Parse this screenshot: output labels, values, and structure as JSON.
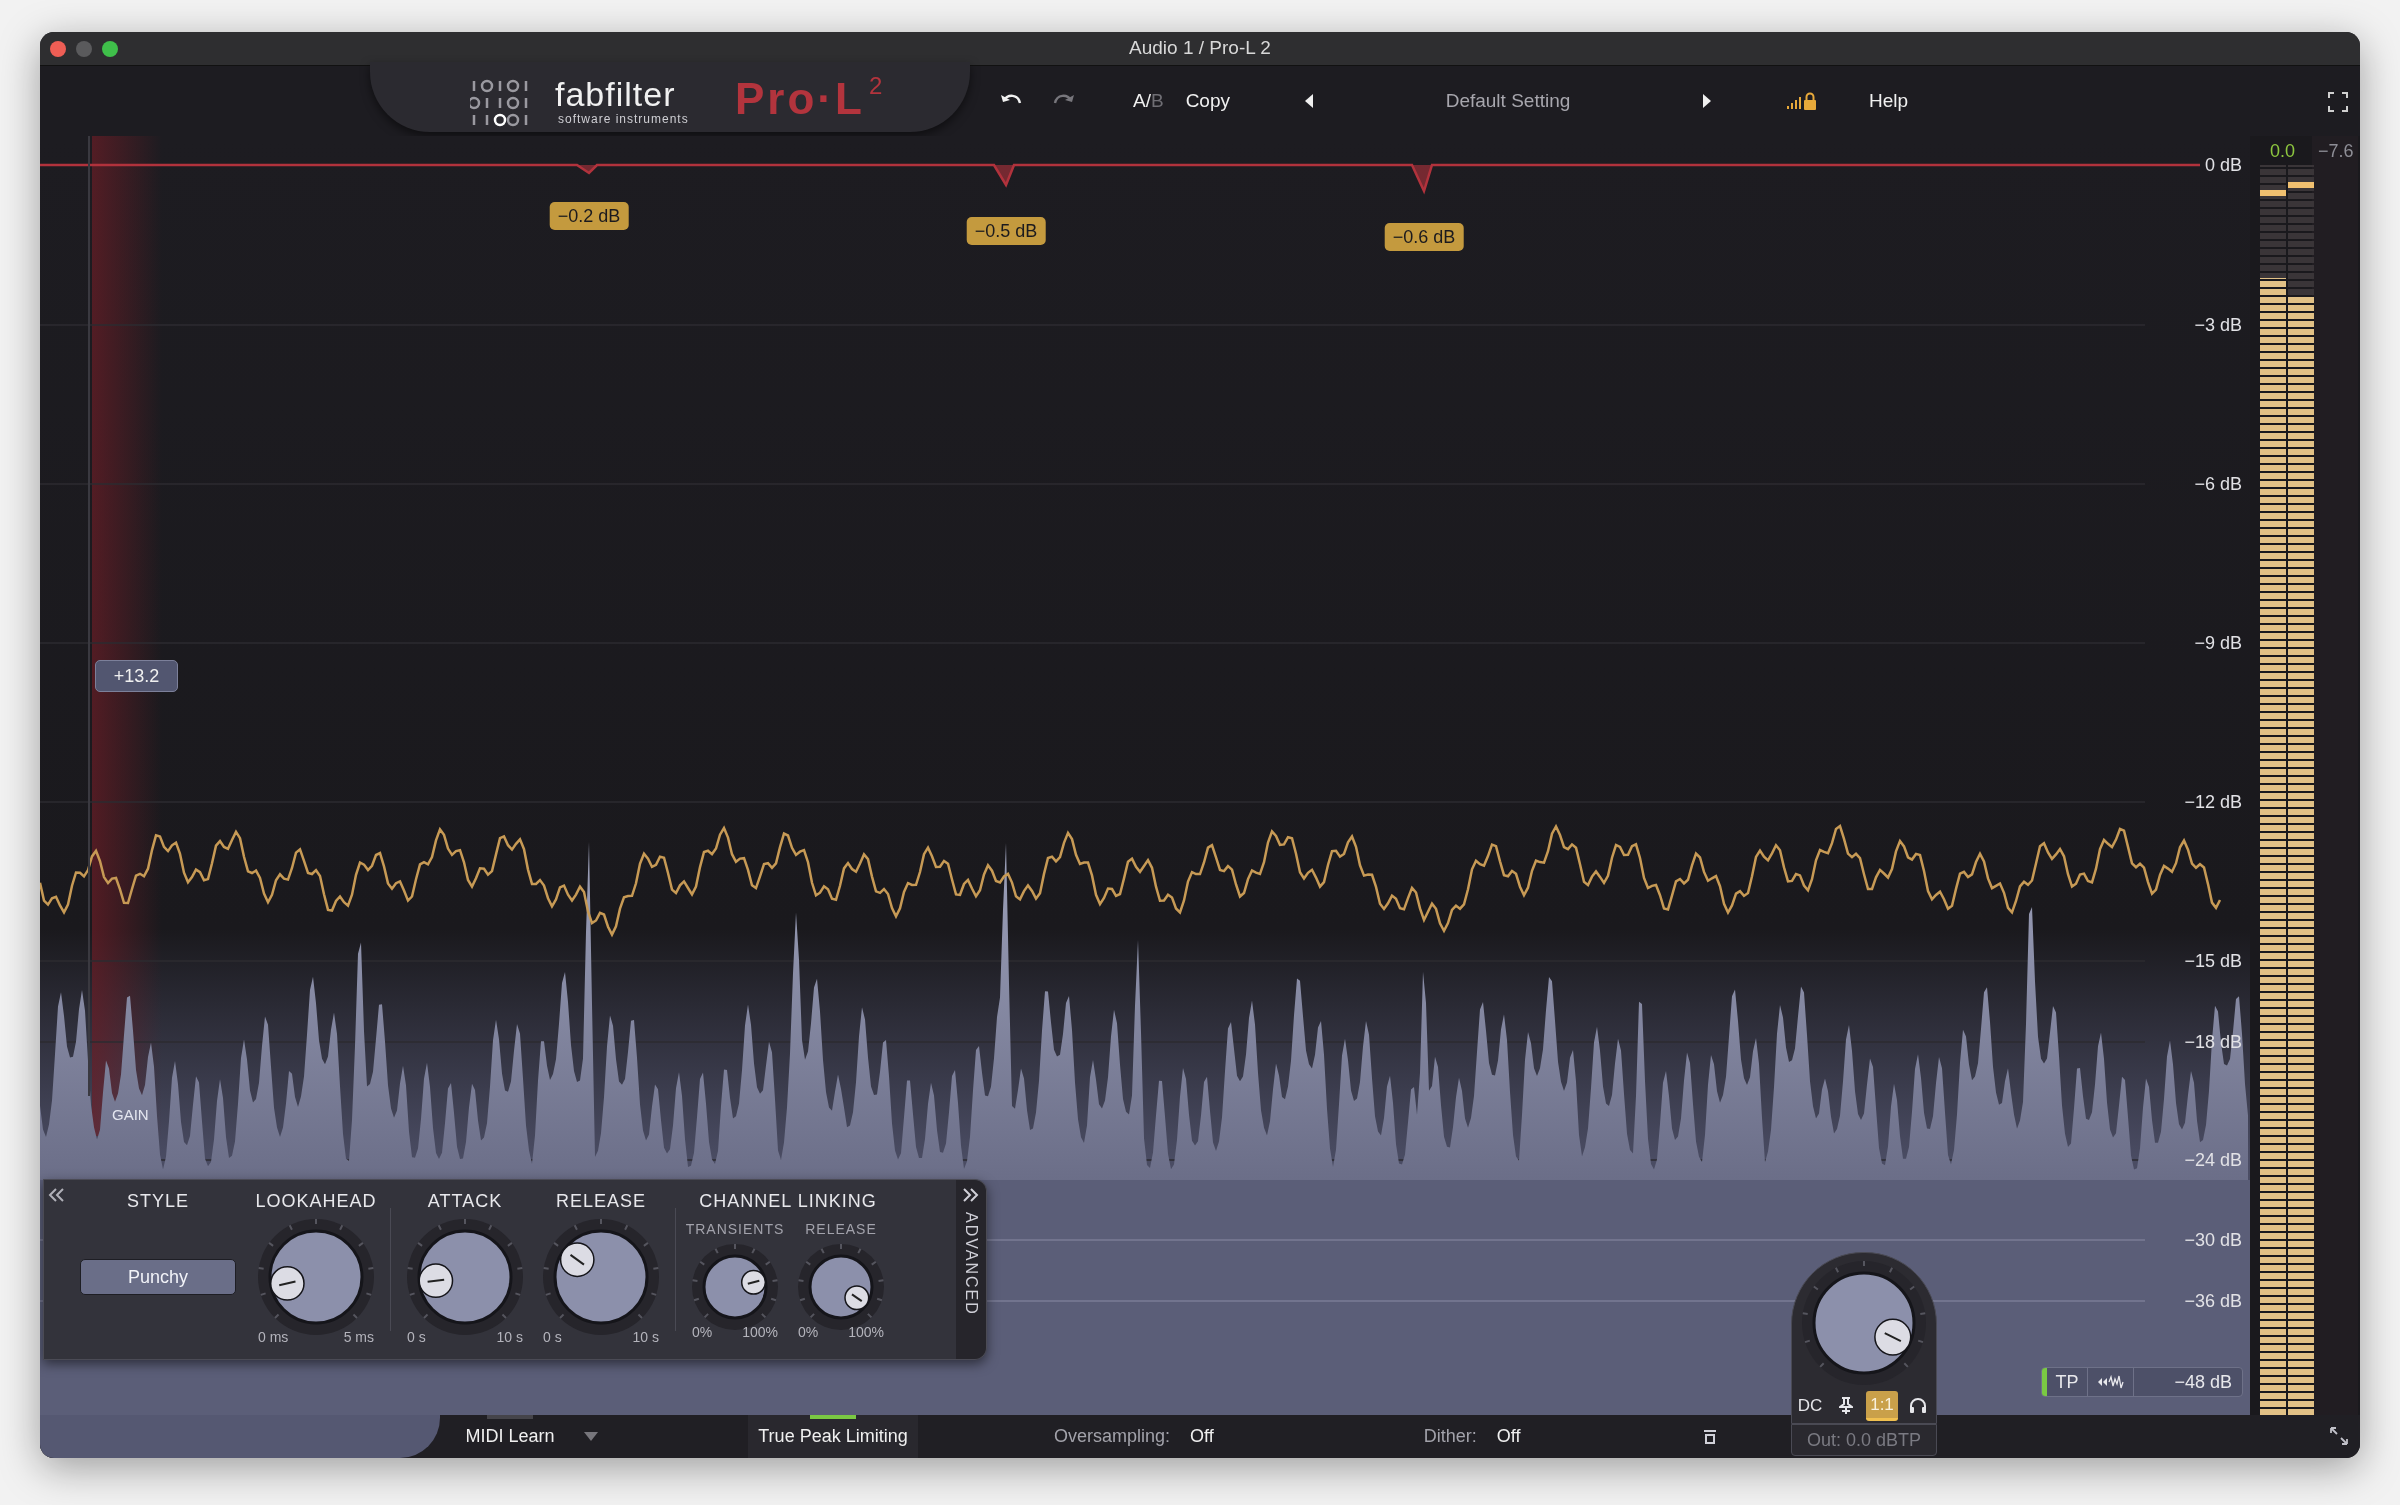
{
  "window": {
    "title": "Audio 1 / Pro-L 2"
  },
  "header": {
    "brand": "fabfilter",
    "brand_sub": "software instruments",
    "product": "Pro·L",
    "product_sup": "2",
    "ab": [
      {
        "label": "A/",
        "selected": true
      },
      {
        "label": "B",
        "selected": false
      }
    ],
    "copy": "Copy",
    "preset": "Default Setting",
    "help": "Help"
  },
  "display": {
    "scale": [
      "0 dB",
      "−3 dB",
      "−6 dB",
      "−9 dB",
      "−12 dB",
      "−15 dB",
      "−18 dB",
      "−24 dB",
      "−30 dB",
      "−36 dB"
    ],
    "reductions": [
      {
        "label": "−0.2 dB"
      },
      {
        "label": "−0.5 dB"
      },
      {
        "label": "−0.6 dB"
      }
    ],
    "gain": {
      "value": "+13.2",
      "caption": "GAIN"
    },
    "meter_readouts": [
      "0.0",
      "−7.6"
    ],
    "meter_channels": [
      {
        "level": 0.91
      },
      {
        "level": 0.895
      }
    ],
    "tp": {
      "label": "TP",
      "on": true
    },
    "range": "−48 dB"
  },
  "controls": {
    "style": {
      "title": "STYLE",
      "value": "Punchy"
    },
    "knobs": [
      {
        "title": "LOOKAHEAD",
        "min": "0 ms",
        "max": "5 ms"
      },
      {
        "title": "ATTACK",
        "min": "0 s",
        "max": "10 s"
      },
      {
        "title": "RELEASE",
        "min": "0 s",
        "max": "10 s"
      }
    ],
    "linking": {
      "title": "CHANNEL LINKING",
      "knobs": [
        {
          "title": "TRANSIENTS",
          "min": "0%",
          "max": "100%"
        },
        {
          "title": "RELEASE",
          "min": "0%",
          "max": "100%"
        }
      ]
    },
    "advanced": "ADVANCED"
  },
  "output": {
    "buttons": [
      {
        "kind": "text",
        "label": "DC",
        "selected": false
      },
      {
        "kind": "pin",
        "selected": false
      },
      {
        "kind": "text",
        "label": "1:1",
        "selected": true
      },
      {
        "kind": "headphones",
        "selected": false
      }
    ],
    "out": "Out: 0.0 dBTP"
  },
  "status_bar": {
    "midi": {
      "label": "MIDI Learn",
      "on": false
    },
    "true_peak": {
      "label": "True Peak Limiting",
      "on": true
    },
    "oversampling": {
      "label": "Oversampling:",
      "value": "Off"
    },
    "dither": {
      "label": "Dither:",
      "value": "Off"
    }
  }
}
